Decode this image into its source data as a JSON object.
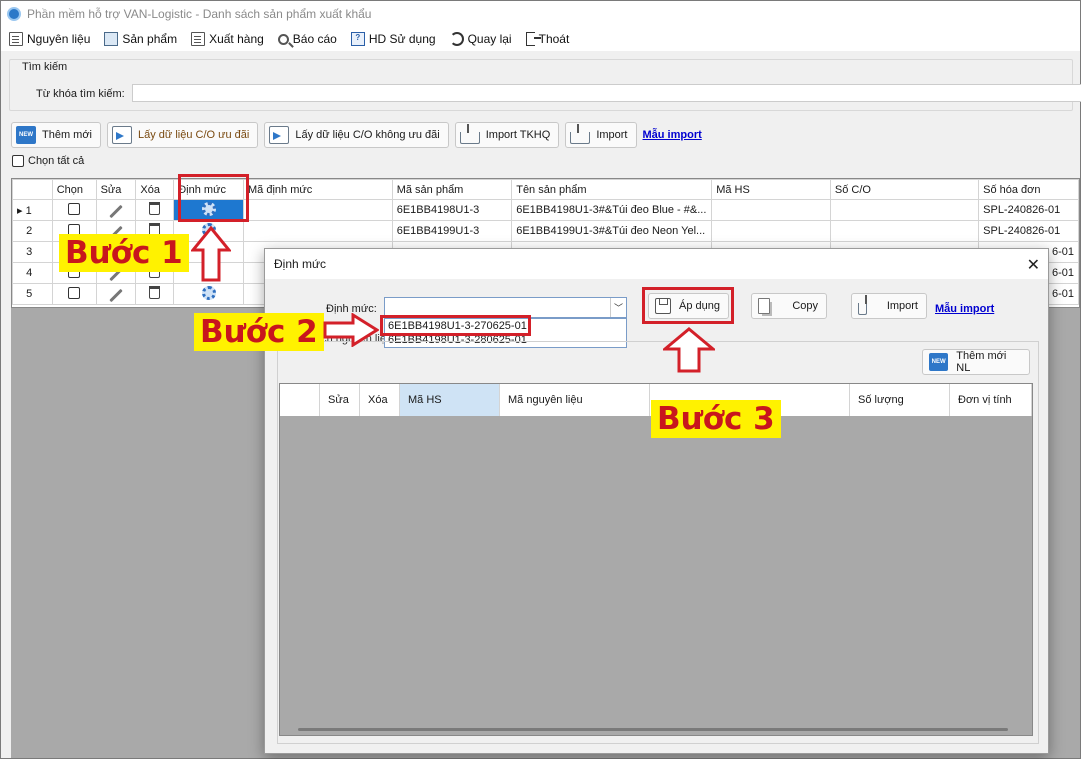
{
  "window": {
    "title": "Phần mềm hỗ trợ VAN-Logistic - Danh sách sản phẩm xuất khẩu"
  },
  "menu": {
    "items": [
      {
        "label": "Nguyên liệu",
        "icon": "document-icon"
      },
      {
        "label": "Sản phẩm",
        "icon": "image-icon"
      },
      {
        "label": "Xuất hàng",
        "icon": "document-icon"
      },
      {
        "label": "Báo cáo",
        "icon": "search-icon"
      },
      {
        "label": "HD Sử dụng",
        "icon": "help-icon"
      },
      {
        "label": "Quay lại",
        "icon": "refresh-icon"
      },
      {
        "label": "Thoát",
        "icon": "exit-icon"
      }
    ]
  },
  "search": {
    "group_label": "Tìm kiếm",
    "keyword_label": "Từ khóa tìm kiếm:",
    "keyword_value": ""
  },
  "toolbar": {
    "add_new": "Thêm mới",
    "get_co_pref": "Lấy dữ liệu C/O ưu đãi",
    "get_co_nonpref": "Lấy dữ liệu C/O không ưu đãi",
    "import_tkhq": "Import TKHQ",
    "import": "Import",
    "template_link": "Mẫu import"
  },
  "select_all": "Chọn tất cả",
  "grid": {
    "columns": [
      "Chọn",
      "Sửa",
      "Xóa",
      "Định mức",
      "Mã định mức",
      "Mã sản phẩm",
      "Tên sản phẩm",
      "Mã HS",
      "Số C/O",
      "Số hóa đơn"
    ],
    "rows": [
      {
        "num": "1",
        "ma_dinh_muc": "",
        "ma_sp": "6E1BB4198U1-3",
        "ten_sp": "6E1BB4198U1-3#&Túi đeo    Blue - #&...",
        "ma_hs": "",
        "so_co": "",
        "so_hd": "SPL-240826-01"
      },
      {
        "num": "2",
        "ma_dinh_muc": "",
        "ma_sp": "6E1BB4199U1-3",
        "ten_sp": "6E1BB4199U1-3#&Túi đeo    Neon Yel...",
        "ma_hs": "",
        "so_co": "",
        "so_hd": "SPL-240826-01"
      },
      {
        "num": "3",
        "ma_dinh_muc": "",
        "ma_sp": "",
        "ten_sp": "",
        "ma_hs": "",
        "so_co": "",
        "so_hd": "6-01"
      },
      {
        "num": "4",
        "ma_dinh_muc": "",
        "ma_sp": "",
        "ten_sp": "",
        "ma_hs": "",
        "so_co": "",
        "so_hd": "6-01"
      },
      {
        "num": "5",
        "ma_dinh_muc": "",
        "ma_sp": "",
        "ten_sp": "",
        "ma_hs": "",
        "so_co": "",
        "so_hd": "6-01"
      }
    ]
  },
  "dialog": {
    "title": "Định mức",
    "label": "Định mức:",
    "combo_value": "",
    "options": [
      "6E1BB4198U1-3-270625-01",
      "6E1BB4198U1-3-280625-01"
    ],
    "behind_label": "ách nguyên liệ",
    "apply": "Áp dụng",
    "copy": "Copy",
    "import": "Import",
    "template_link": "Mẫu import",
    "add_material": "Thêm mới NL",
    "columns": [
      "Sửa",
      "Xóa",
      "Mã HS",
      "Mã nguyên liệu",
      "",
      "Số lượng",
      "Đơn vị tính"
    ]
  },
  "annotations": {
    "step1": "Bước 1",
    "step2": "Bước 2",
    "step3": "Bước 3"
  },
  "colors": {
    "highlight": "#d32029",
    "label_bg": "#fff200",
    "selection": "#1e78d0"
  }
}
